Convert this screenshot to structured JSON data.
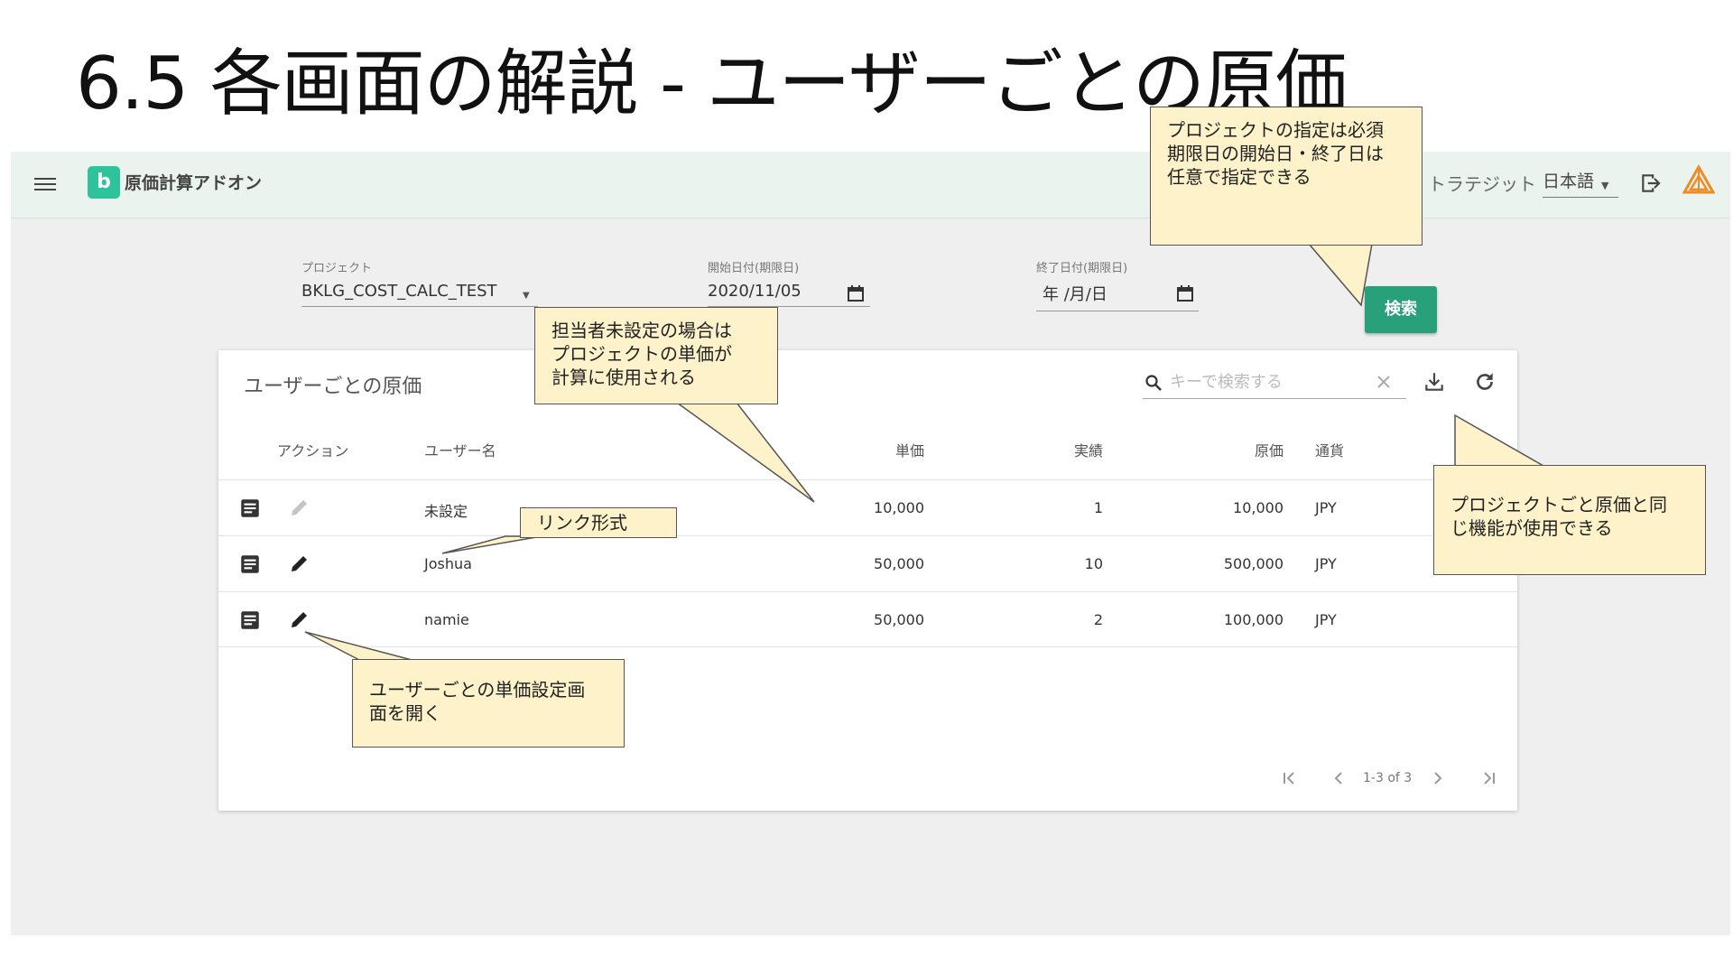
{
  "slide": {
    "title": "6.5 各画面の解説 - ユーザーごとの原価"
  },
  "appbar": {
    "logo_letter": "b",
    "app_name": "原価計算アドオン",
    "space_name": "トラテジット",
    "language": "日本語"
  },
  "filters": {
    "project_label": "プロジェクト",
    "project_value": "BKLG_COST_CALC_TEST",
    "start_label": "開始日付(期限日)",
    "start_value": "2020/11/05",
    "end_label": "終了日付(期限日)",
    "end_value": "年 /月/日",
    "search_button": "検索"
  },
  "card": {
    "title": "ユーザーごとの原価",
    "search_placeholder": "キーで検索する",
    "columns": [
      "アクション",
      "ユーザー名",
      "単価",
      "実績",
      "原価",
      "通貨"
    ],
    "rows": [
      {
        "user": "未設定",
        "unit_price": "10,000",
        "actual": "1",
        "cost": "10,000",
        "currency": "JPY",
        "edit_enabled": false
      },
      {
        "user": "Joshua",
        "unit_price": "50,000",
        "actual": "10",
        "cost": "500,000",
        "currency": "JPY",
        "edit_enabled": true
      },
      {
        "user": "namie",
        "unit_price": "50,000",
        "actual": "2",
        "cost": "100,000",
        "currency": "JPY",
        "edit_enabled": true
      }
    ],
    "pagination": "1-3 of 3"
  },
  "callouts": {
    "project_required": [
      "プロジェクトの指定は必須",
      "期限日の開始日・終了日は",
      "任意で指定できる"
    ],
    "unassigned": [
      "担当者未設定の場合は",
      "プロジェクトの単価が",
      "計算に使用される"
    ],
    "link_format": [
      "リンク形式"
    ],
    "same_function": [
      "プロジェクトごと原価と同",
      "じ機能が使用できる"
    ],
    "unit_price_screen": [
      "ユーザーごとの単価設定画",
      "面を開く"
    ]
  },
  "colors": {
    "accent_green": "#28a07a",
    "logo_green": "#2ec39a",
    "appbar_bg": "#ebf3ee",
    "callout_bg": "#fdf2c9",
    "brand_orange": "#f08a24"
  }
}
